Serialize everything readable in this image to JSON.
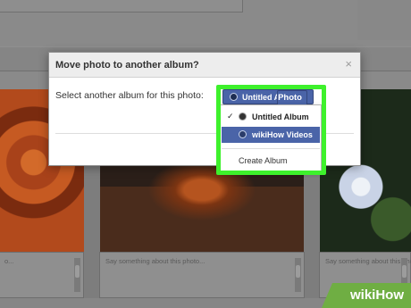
{
  "dialog": {
    "title": "Move photo to another album?",
    "close_glyph": "×",
    "prompt_label": "Select another album for this photo:",
    "album_button_label": "Untitled Album",
    "photo_button_label": "Photo"
  },
  "dropdown": {
    "items": [
      {
        "label": "Untitled Album",
        "checked": true,
        "check_glyph": "✓"
      },
      {
        "label": "wikiHow Videos",
        "highlighted": true
      },
      {
        "label": "Create Album"
      }
    ]
  },
  "background": {
    "caption_placeholder": "Say something about this photo...",
    "caption_fragment_left": "o..."
  },
  "colors": {
    "accent_blue": "#4a64a8",
    "highlight_green": "#3ef12c",
    "watermark_green": "#6fae43"
  },
  "watermark": {
    "text": "wikiHow"
  }
}
